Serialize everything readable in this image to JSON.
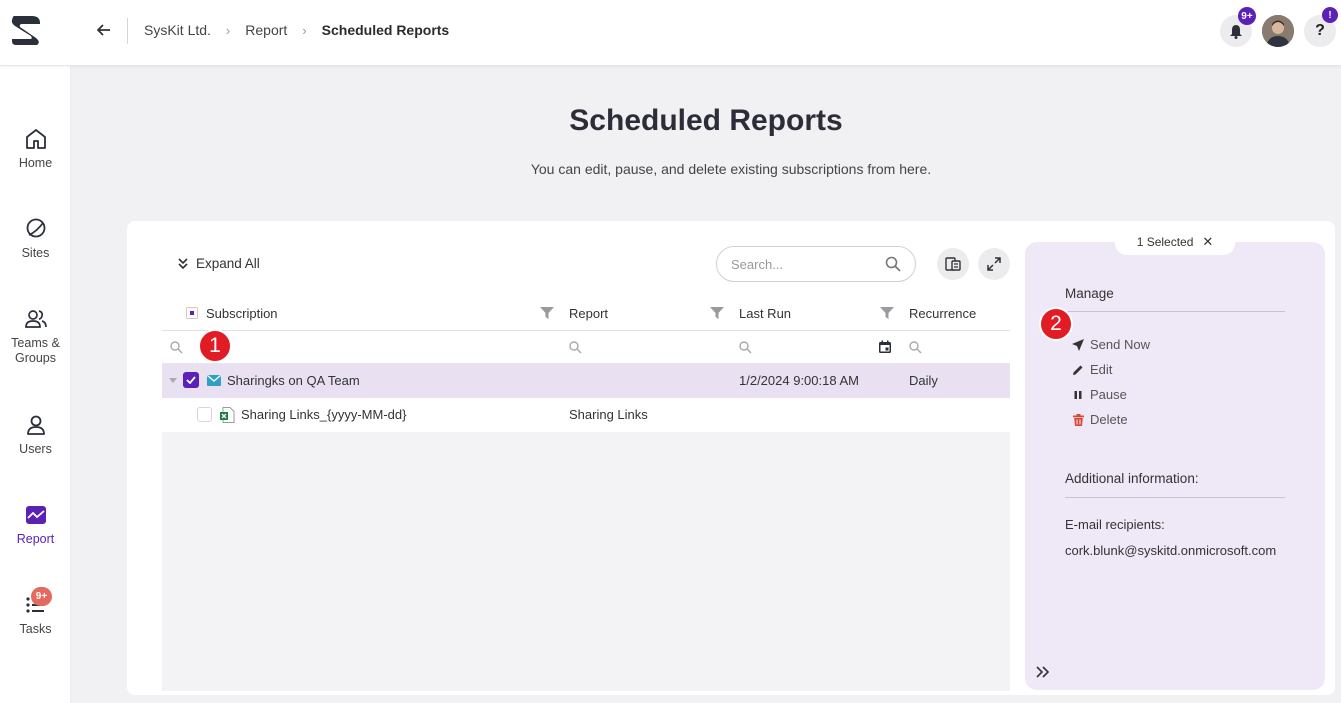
{
  "breadcrumb": {
    "items": [
      "SysKit Ltd.",
      "Report"
    ],
    "current": "Scheduled Reports"
  },
  "topbar": {
    "notification_badge": "9+",
    "help_label": "?",
    "help_badge": "!"
  },
  "sidebar": {
    "items": [
      {
        "label": "Home",
        "icon": "home-icon"
      },
      {
        "label": "Sites",
        "icon": "sites-icon"
      },
      {
        "label": "Teams & Groups",
        "icon": "teams-groups-icon"
      },
      {
        "label": "Users",
        "icon": "user-icon"
      },
      {
        "label": "Report",
        "icon": "report-icon",
        "active": true
      },
      {
        "label": "Tasks",
        "icon": "tasks-icon",
        "badge": "9+"
      }
    ]
  },
  "header": {
    "title": "Scheduled Reports",
    "subtitle": "You can edit, pause, and delete existing subscriptions from here."
  },
  "toolbar": {
    "expand_all": "Expand All",
    "search_placeholder": "Search..."
  },
  "table": {
    "columns": [
      "Subscription",
      "Report",
      "Last Run",
      "Recurrence"
    ],
    "rows": [
      {
        "subscription": "Sharingks on QA Team",
        "report": "",
        "last_run": "1/2/2024 9:00:18 AM",
        "recurrence": "Daily",
        "selected": true
      },
      {
        "subscription": "Sharing Links_{yyyy-MM-dd}",
        "report": "Sharing Links",
        "last_run": "",
        "recurrence": "",
        "selected": false
      }
    ]
  },
  "steps": [
    "1",
    "2"
  ],
  "panel": {
    "selected_label": "1 Selected",
    "close_label": "✕",
    "manage_heading": "Manage",
    "actions": [
      "Send Now",
      "Edit",
      "Pause",
      "Delete"
    ],
    "additional_heading": "Additional information:",
    "recipients_label": "E-mail recipients:",
    "recipients_value": "cork.blunk@syskitd.onmicrosoft.com"
  },
  "colors": {
    "accent": "#5b21b6",
    "selected_row": "#e9e1f2",
    "panel_bg": "#efe9f7",
    "step_badge": "#e11c24",
    "delete": "#d9473a"
  }
}
